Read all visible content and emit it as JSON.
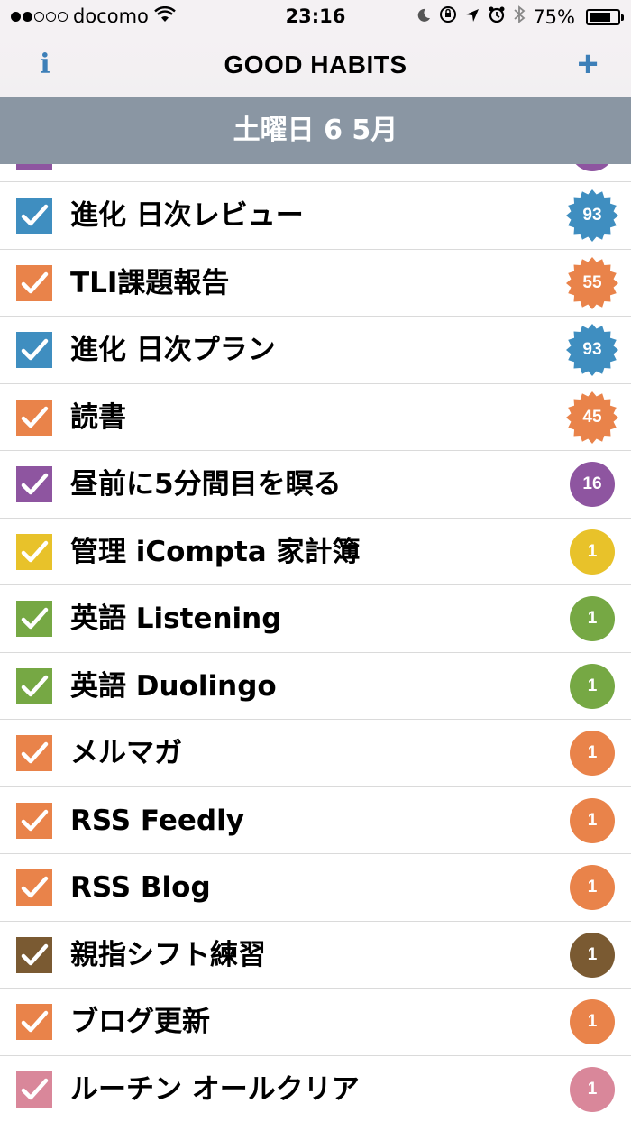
{
  "status_bar": {
    "carrier": "docomo",
    "time": "23:16",
    "battery": "75%",
    "battery_level": 0.75
  },
  "nav": {
    "info_label": "i",
    "title": "GOOD HABITS",
    "add_label": "+"
  },
  "date_header": "土曜日 6 5月",
  "partial_item": {
    "color": "#8e55a0"
  },
  "habits": [
    {
      "label": "進化 日次レビュー",
      "count": "93",
      "color": "#3f8ec0",
      "badge_shape": "star"
    },
    {
      "label": "TLI課題報告",
      "count": "55",
      "color": "#e9834a",
      "badge_shape": "star"
    },
    {
      "label": "進化 日次プラン",
      "count": "93",
      "color": "#3f8ec0",
      "badge_shape": "star"
    },
    {
      "label": "読書",
      "count": "45",
      "color": "#e9834a",
      "badge_shape": "star"
    },
    {
      "label": "昼前に5分間目を瞑る",
      "count": "16",
      "color": "#8e55a0",
      "badge_shape": "circle"
    },
    {
      "label": "管理 iCompta 家計簿",
      "count": "1",
      "color": "#e8c22a",
      "badge_shape": "circle"
    },
    {
      "label": "英語 Listening",
      "count": "1",
      "color": "#76a844",
      "badge_shape": "circle"
    },
    {
      "label": "英語 Duolingo",
      "count": "1",
      "color": "#76a844",
      "badge_shape": "circle"
    },
    {
      "label": "メルマガ",
      "count": "1",
      "color": "#e9834a",
      "badge_shape": "circle"
    },
    {
      "label": "RSS Feedly",
      "count": "1",
      "color": "#e9834a",
      "badge_shape": "circle"
    },
    {
      "label": "RSS Blog",
      "count": "1",
      "color": "#e9834a",
      "badge_shape": "circle"
    },
    {
      "label": "親指シフト練習",
      "count": "1",
      "color": "#7a5a32",
      "badge_shape": "circle"
    },
    {
      "label": "ブログ更新",
      "count": "1",
      "color": "#e9834a",
      "badge_shape": "circle"
    },
    {
      "label": "ルーチン オールクリア",
      "count": "1",
      "color": "#d9879a",
      "badge_shape": "circle"
    }
  ]
}
